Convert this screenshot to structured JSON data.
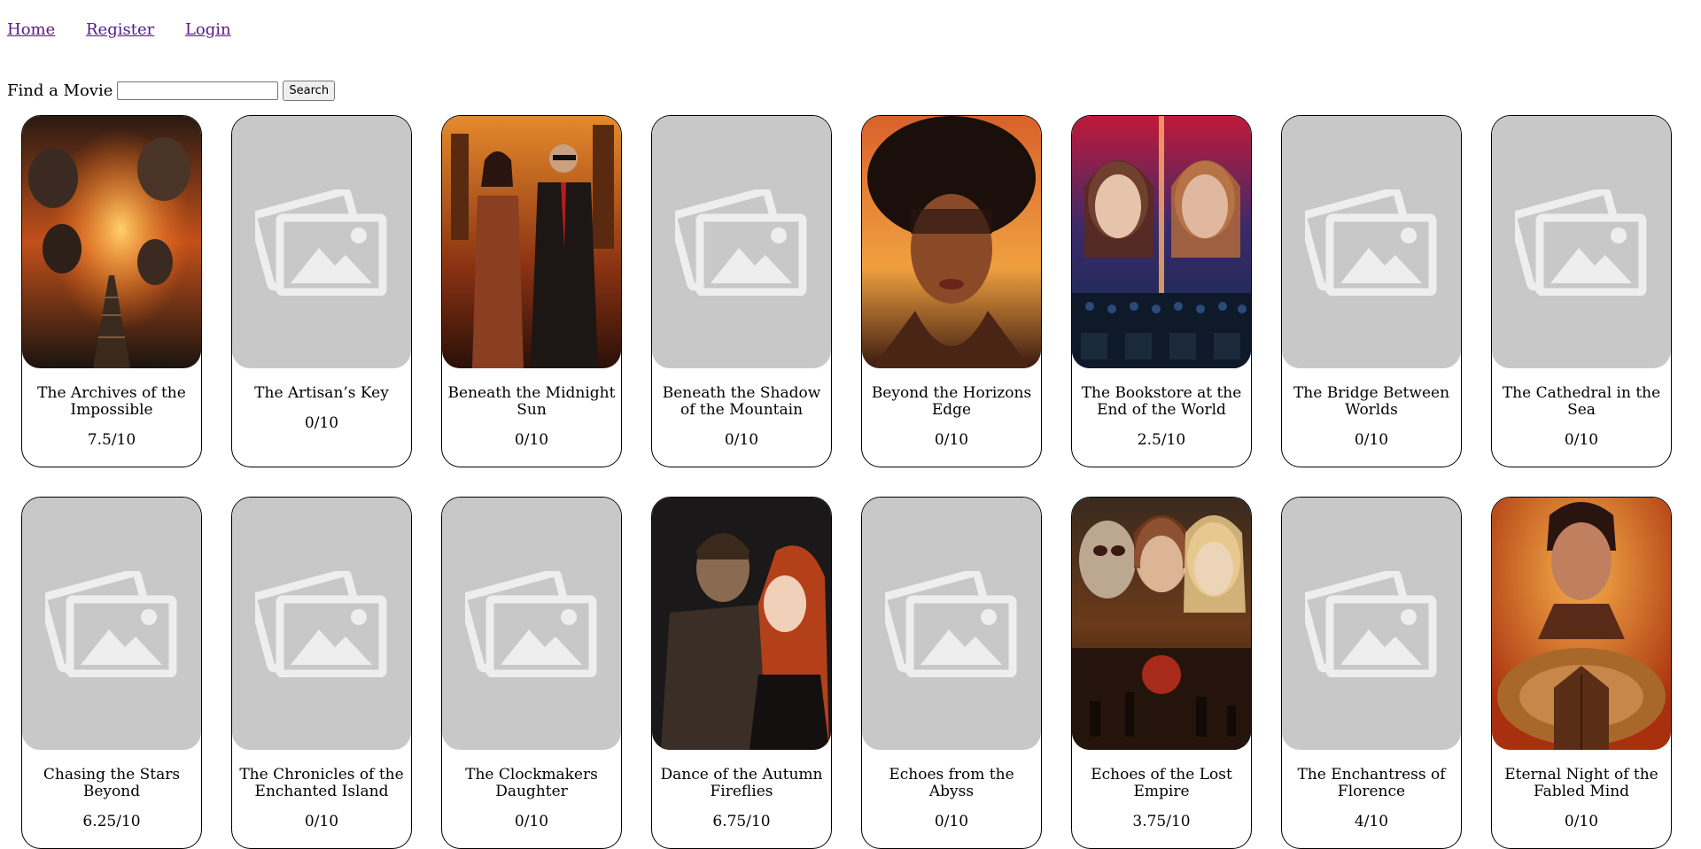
{
  "nav": {
    "home": "Home",
    "register": "Register",
    "login": "Login"
  },
  "search": {
    "label": "Find a Movie",
    "placeholder": "",
    "button": "Search"
  },
  "movies": [
    {
      "title": "The Archives of the Impossible",
      "rating": "7.5/10",
      "poster": "fire-ruins"
    },
    {
      "title": "The Artisan’s Key",
      "rating": "0/10",
      "poster": "placeholder"
    },
    {
      "title": "Beneath the Midnight Sun",
      "rating": "0/10",
      "poster": "noir-couple"
    },
    {
      "title": "Beneath the Shadow of the Mountain",
      "rating": "0/10",
      "poster": "placeholder"
    },
    {
      "title": "Beyond the Horizons Edge",
      "rating": "0/10",
      "poster": "afro-portrait"
    },
    {
      "title": "The Bookstore at the End of the World",
      "rating": "2.5/10",
      "poster": "two-women-theater"
    },
    {
      "title": "The Bridge Between Worlds",
      "rating": "0/10",
      "poster": "placeholder"
    },
    {
      "title": "The Cathedral in the Sea",
      "rating": "0/10",
      "poster": "placeholder"
    },
    {
      "title": "Chasing the Stars Beyond",
      "rating": "6.25/10",
      "poster": "placeholder"
    },
    {
      "title": "The Chronicles of the Enchanted Island",
      "rating": "0/10",
      "poster": "placeholder"
    },
    {
      "title": "The Clockmakers Daughter",
      "rating": "0/10",
      "poster": "placeholder"
    },
    {
      "title": "Dance of the Autumn Fireflies",
      "rating": "6.75/10",
      "poster": "romance-couple"
    },
    {
      "title": "Echoes from the Abyss",
      "rating": "0/10",
      "poster": "placeholder"
    },
    {
      "title": "Echoes of the Lost Empire",
      "rating": "3.75/10",
      "poster": "horror-trio"
    },
    {
      "title": "The Enchantress of Florence",
      "rating": "4/10",
      "poster": "placeholder"
    },
    {
      "title": "Eternal Night of the Fabled Mind",
      "rating": "0/10",
      "poster": "serpent-woman"
    }
  ],
  "colors": {
    "link": "#551a8b",
    "placeholder_bg": "#c8c8c8",
    "placeholder_icon": "#eeeeee",
    "card_border": "#000000"
  }
}
